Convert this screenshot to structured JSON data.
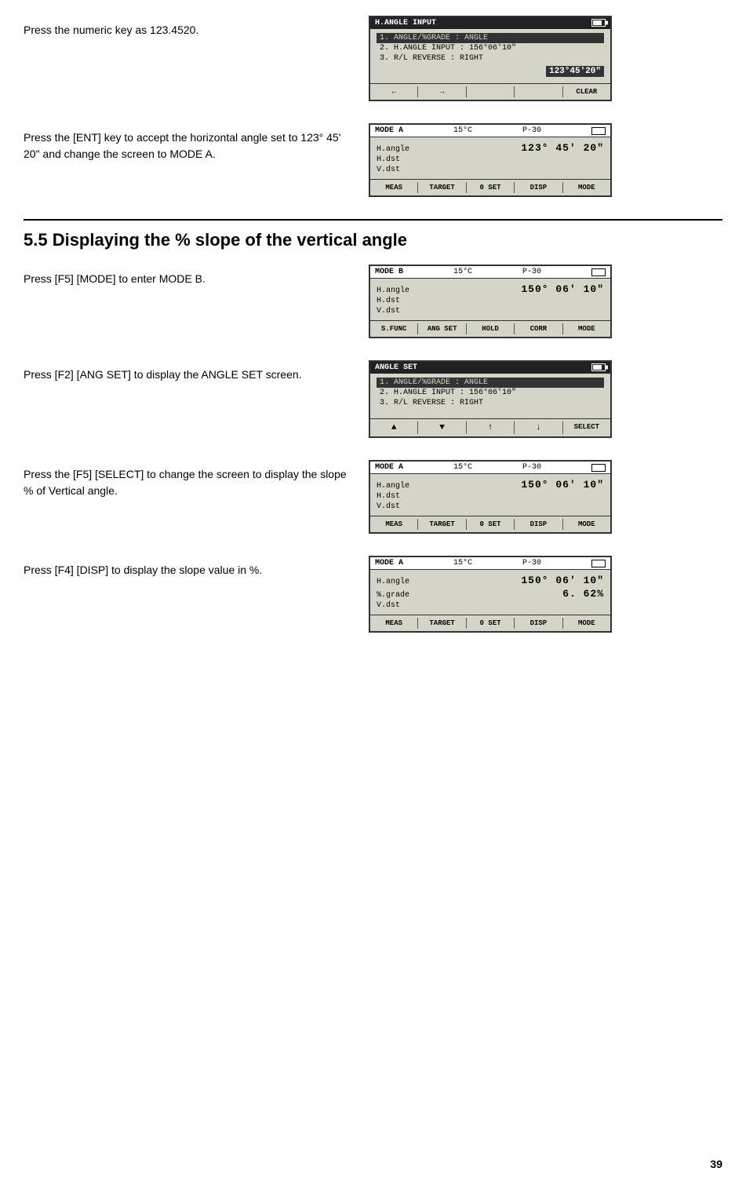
{
  "page": {
    "number": "39"
  },
  "section1": {
    "instruction": "Press the numeric key as 123.4520.",
    "screen": {
      "header": "H.ANGLE INPUT",
      "items": [
        "1. ANGLE/%GRADE  : ANGLE",
        "2. H.ANGLE INPUT : 156°06'10\"",
        "3. R/L REVERSE   : RIGHT"
      ],
      "input_value": "123°45'20\"",
      "buttons": [
        "←",
        "→",
        "",
        "",
        "CLEAR"
      ]
    }
  },
  "section2": {
    "instruction": "Press the [ENT] key to accept the horizontal angle set to 123° 45' 20\" and change the screen to MODE A.",
    "screen": {
      "mode": "MODE A",
      "temp": "15°C",
      "page": "P-30",
      "rows": [
        {
          "label": "H.angle",
          "value": "123° 45′ 20″"
        },
        {
          "label": "H.dst",
          "value": ""
        },
        {
          "label": "V.dst",
          "value": ""
        }
      ],
      "buttons": [
        "MEAS",
        "TARGET",
        "0 SET",
        "DISP",
        "MODE"
      ]
    }
  },
  "section_heading": "5.5 Displaying the % slope of the vertical angle",
  "section3": {
    "instruction": "Press [F5] [MODE] to enter MODE B.",
    "screen": {
      "mode": "MODE B",
      "temp": "15°C",
      "page": "P-30",
      "rows": [
        {
          "label": "H.angle",
          "value": "150° 06′ 10″"
        },
        {
          "label": "H.dst",
          "value": ""
        },
        {
          "label": "V.dst",
          "value": ""
        }
      ],
      "buttons": [
        "S.FUNC",
        "ANG SET",
        "HOLD",
        "CORR",
        "MODE"
      ]
    }
  },
  "section4": {
    "instruction": "Press [F2] [ANG SET] to display the ANGLE SET screen.",
    "screen": {
      "header": "ANGLE SET",
      "items": [
        "1. ANGLE/%GRADE : ANGLE",
        "2. H.ANGLE INPUT : 156°06'10\"",
        "3. R/L REVERSE  : RIGHT"
      ],
      "buttons": [
        "▲",
        "▼",
        "↑",
        "↓",
        "SELECT"
      ]
    }
  },
  "section5": {
    "instruction": "Press the [F5] [SELECT] to change the screen to display the slope % of Vertical angle.",
    "screen": {
      "mode": "MODE A",
      "temp": "15°C",
      "page": "P-30",
      "rows": [
        {
          "label": "H.angle",
          "value": "150° 06′ 10″"
        },
        {
          "label": "H.dst",
          "value": ""
        },
        {
          "label": "V.dst",
          "value": ""
        }
      ],
      "buttons": [
        "MEAS",
        "TARGET",
        "0 SET",
        "DISP",
        "MODE"
      ]
    }
  },
  "section6": {
    "instruction": "Press [F4] [DISP] to display the slope value in %.",
    "screen": {
      "mode": "MODE A",
      "temp": "15°C",
      "page": "P-30",
      "rows": [
        {
          "label": "H.angle",
          "value": "150° 06′ 10″"
        },
        {
          "label": "%.grade",
          "value": "6. 62%"
        },
        {
          "label": "V.dst",
          "value": ""
        }
      ],
      "buttons": [
        "MEAS",
        "TARGET",
        "0 SET",
        "DISP",
        "MODE"
      ]
    }
  }
}
